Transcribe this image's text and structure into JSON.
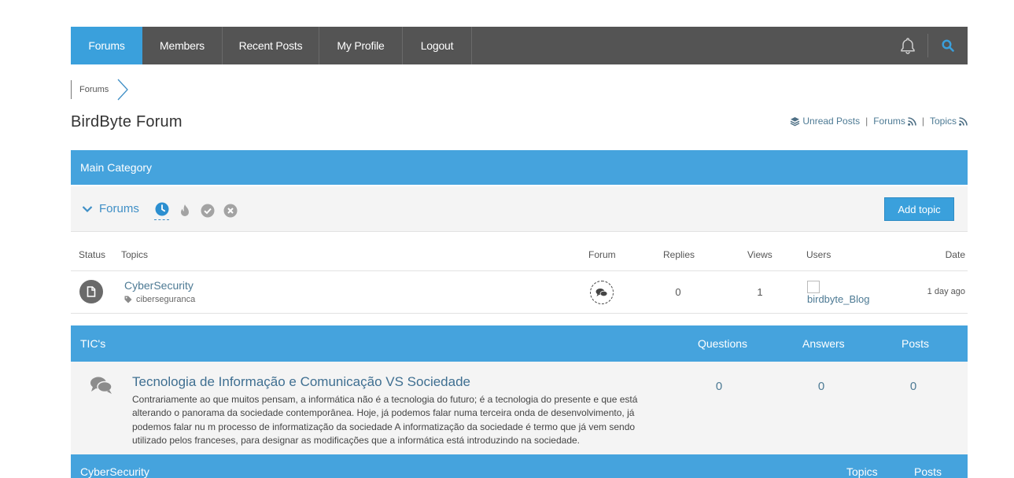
{
  "nav": {
    "items": [
      "Forums",
      "Members",
      "Recent Posts",
      "My Profile",
      "Logout"
    ],
    "icons": {
      "notifications": "bell-icon",
      "search": "search-icon"
    }
  },
  "breadcrumb": {
    "item": "Forums"
  },
  "page": {
    "title": "BirdByte Forum"
  },
  "top_links": {
    "unread": "Unread Posts",
    "forums": "Forums",
    "topics": "Topics",
    "sep": "|"
  },
  "main_category": {
    "title": "Main Category",
    "forums_toggle": "Forums",
    "add_topic": "Add topic",
    "columns": [
      "Status",
      "Topics",
      "Forum",
      "Replies",
      "Views",
      "Users",
      "Date"
    ],
    "rows": [
      {
        "title": "CyberSecurity",
        "tag": "ciberseguranca",
        "replies": "0",
        "views": "1",
        "user": "birdbyte_Blog",
        "date": "1 day ago"
      }
    ]
  },
  "tics": {
    "title": "TIC's",
    "columns": [
      "Questions",
      "Answers",
      "Posts"
    ],
    "forum": {
      "title": "Tecnologia de Informação e Comunicação VS Sociedade",
      "description": "Contrariamente ao que muitos pensam, a informática não é a tecnologia do futuro; é a tecnologia do presente e que está alterando o panorama da sociedade contemporânea. Hoje, já podemos falar numa terceira onda de desenvolvimento, já podemos falar nu m processo de informatização da sociedade A informatização da sociedade é termo que já vem sendo utilizado pelos franceses, para designar as modificações que a informática está introduzindo na sociedade.",
      "questions": "0",
      "answers": "0",
      "posts": "0"
    }
  },
  "next_category": {
    "title": "CyberSecurity",
    "col1": "Topics",
    "col2": "Posts"
  },
  "colors": {
    "accent": "#45a3dd",
    "nav_bg": "#545454",
    "link": "#4d7a94"
  }
}
